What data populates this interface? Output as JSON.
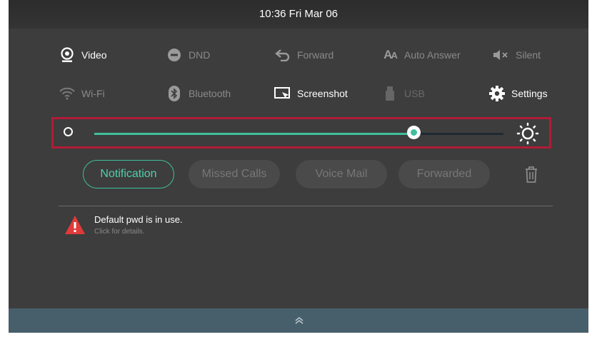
{
  "status_bar": {
    "clock": "10:36 Fri Mar 06"
  },
  "quick_settings": {
    "row1": [
      {
        "label": "Video",
        "icon": "video-icon",
        "active": true
      },
      {
        "label": "DND",
        "icon": "dnd-icon",
        "active": false
      },
      {
        "label": "Forward",
        "icon": "forward-icon",
        "active": false
      },
      {
        "label": "Auto Answer",
        "icon": "auto-answer-icon",
        "active": false
      },
      {
        "label": "Silent",
        "icon": "silent-icon",
        "active": false
      }
    ],
    "row2": [
      {
        "label": "Wi-Fi",
        "icon": "wifi-icon",
        "active": false
      },
      {
        "label": "Bluetooth",
        "icon": "bluetooth-icon",
        "active": false
      },
      {
        "label": "Screenshot",
        "icon": "screenshot-icon",
        "active": true
      },
      {
        "label": "USB",
        "icon": "usb-icon",
        "active": false
      },
      {
        "label": "Settings",
        "icon": "gear-icon",
        "active": true
      }
    ]
  },
  "brightness": {
    "level": 0.78,
    "highlight_color": "#b01c37"
  },
  "tabs": [
    {
      "label": "Notification",
      "active": true
    },
    {
      "label": "Missed Calls",
      "active": false
    },
    {
      "label": "Voice Mail",
      "active": false
    },
    {
      "label": "Forwarded",
      "active": false
    }
  ],
  "notifications": [
    {
      "title": "Default pwd is in use.",
      "subtitle": "Click for details.",
      "icon": "warning-icon"
    }
  ],
  "colors": {
    "accent": "#3fbf9b",
    "background": "#3d3d3d",
    "bottom_bar": "#475f6b",
    "warning": "#e03a3a"
  }
}
